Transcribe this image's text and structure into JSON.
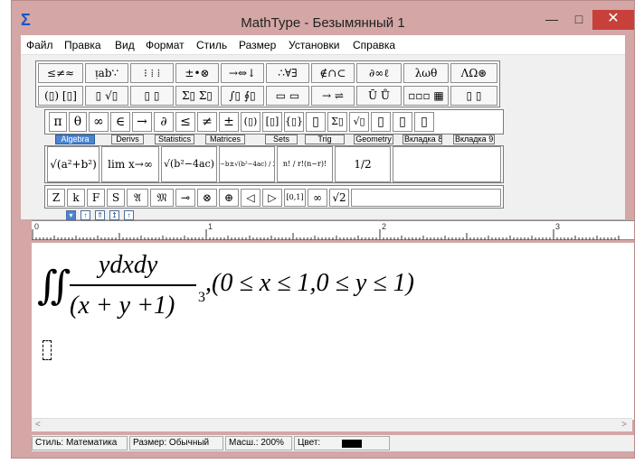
{
  "window": {
    "title": "MathType - Безымянный 1",
    "app_icon": "Σ",
    "minimize_glyph": "—",
    "maximize_glyph": "□",
    "close_glyph": "✕"
  },
  "menu": [
    "Файл",
    "Правка",
    "Вид",
    "Формат",
    "Стиль",
    "Размер",
    "Установки",
    "Справка"
  ],
  "toolbar": {
    "row1": [
      "≤≠≈",
      "ᴉab∵",
      "⁝ ⁞ ⁞",
      "±•⊗",
      "→⇔↓",
      "∴∀∃",
      "∉∩⊂",
      "∂∞ℓ",
      "λωθ",
      "ΛΩ⊛"
    ],
    "row2": [
      "(▯) [▯]",
      "▯ √▯",
      "▯ ▯",
      "Σ▯ Σ▯",
      "∫▯ ∮▯",
      "▭ ▭",
      "→ ⇌",
      "Ū Ů",
      "▫▫▫ ▦",
      "▯ ▯"
    ],
    "symbols": [
      "π",
      "θ",
      "∞",
      "∈",
      "→",
      "∂",
      "≤",
      "≠",
      "±",
      "(▯)",
      "[▯]",
      "{▯}",
      "▯",
      "Σ▯",
      "√▯",
      "▯",
      "▯",
      "▯"
    ],
    "tabs": [
      "Algebra",
      "Derivs",
      "Statistics",
      "Matrices",
      "Sets",
      "Trig",
      "Geometry",
      "Вкладка 8",
      "Вкладка 9"
    ],
    "active_tab": "Algebra",
    "templates": [
      "√(a²+b²)",
      "lim x→∞",
      "√(b²−4ac)",
      "−b±√(b²−4ac) / 2a",
      "n! / r!(n−r)!",
      "1/2"
    ],
    "bottom_symbols": [
      "Z",
      "k",
      "F",
      "S",
      "𝔄",
      "𝔐",
      "⊸",
      "⊗",
      "⊕",
      "◁",
      "▷",
      "[0,1]",
      "∞",
      "√2"
    ],
    "size_buttons": [
      "▾",
      "↑",
      "⇑",
      "↥",
      "↑"
    ]
  },
  "ruler": {
    "labels": [
      "0",
      "1",
      "2",
      "3"
    ]
  },
  "formula": {
    "integral": "∬",
    "numerator": "ydxdy",
    "denominator": "(x + y +1)",
    "exponent": "3",
    "condition": ",(0 ≤ x ≤ 1,0 ≤ y ≤ 1)"
  },
  "status": {
    "style": "Стиль: Математика",
    "size": "Размер: Обычный",
    "zoom": "Масш.: 200%",
    "color_label": "Цвет:",
    "color_value": "#000000"
  }
}
